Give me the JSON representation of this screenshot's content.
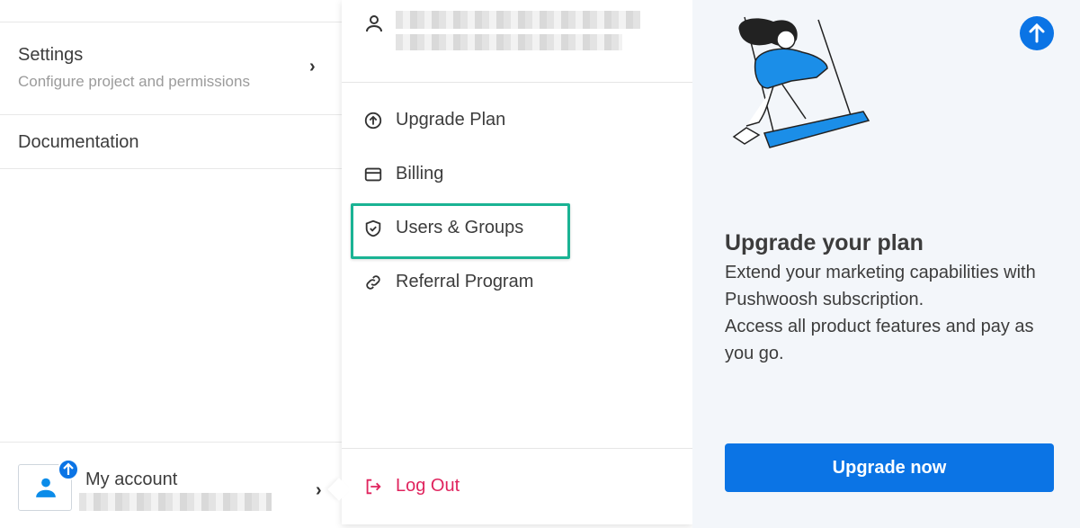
{
  "sidebar": {
    "settings": {
      "title": "Settings",
      "subtitle": "Configure project and permissions"
    },
    "documentation": {
      "title": "Documentation"
    },
    "account": {
      "name": "My account"
    }
  },
  "menu": {
    "items": [
      {
        "label": "Upgrade Plan",
        "icon": "arrow-up-circle-icon"
      },
      {
        "label": "Billing",
        "icon": "credit-card-icon"
      },
      {
        "label": "Users & Groups",
        "icon": "shield-check-icon"
      },
      {
        "label": "Referral Program",
        "icon": "link-icon"
      }
    ],
    "logout": {
      "label": "Log Out",
      "icon": "logout-icon"
    }
  },
  "promo": {
    "title": "Upgrade your plan",
    "body_line1": "Extend your marketing capabilities with Pushwoosh subscription.",
    "body_line2": "Access all product features and pay as you go.",
    "cta_label": "Upgrade now"
  },
  "colors": {
    "accent": "#0b74e5",
    "highlight": "#1ab394",
    "logout": "#e0245e",
    "promo_bg": "#f3f6fa"
  }
}
